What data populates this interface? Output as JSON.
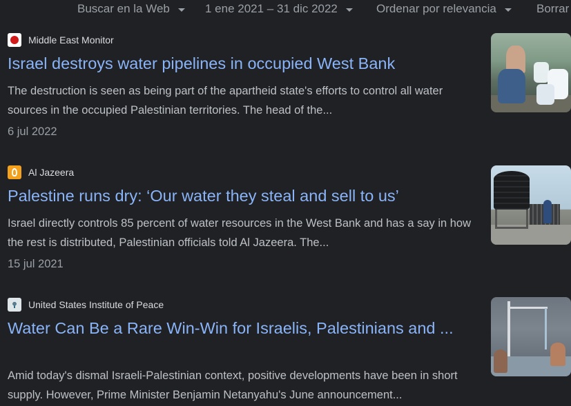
{
  "toolbar": {
    "web_label": "Buscar en la Web",
    "date_label": "1 ene 2021 – 31 dic 2022",
    "sort_label": "Ordenar por relevancia",
    "clear_label": "Borrar"
  },
  "results": [
    {
      "source": "Middle East Monitor",
      "favicon": "middle-east-monitor-icon",
      "title": "Israel destroys water pipelines in occupied West Bank",
      "snippet": "The destruction is seen as being part of the apartheid state's efforts to control all water sources in the occupied Palestinian territories. The head of the...",
      "date": "6 jul 2022"
    },
    {
      "source": "Al Jazeera",
      "favicon": "al-jazeera-icon",
      "title": "Palestine runs dry: ‘Our water they steal and sell to us’",
      "snippet": "Israel directly controls 85 percent of water resources in the West Bank and has a say in how the rest is distributed, Palestinian officials told Al Jazeera. The...",
      "date": "15 jul 2021"
    },
    {
      "source": "United States Institute of Peace",
      "favicon": "usip-icon",
      "title": "Water Can Be a Rare Win-Win for Israelis, Palestinians and ...",
      "snippet": "Amid today's dismal Israeli-Palestinian context, positive developments have been in short supply. However, Prime Minister Benjamin Netanyahu's June announcement..."
    }
  ],
  "colors": {
    "background": "#202124",
    "link": "#8ab4f8",
    "text": "#bdc1c6",
    "muted": "#9aa0a6"
  }
}
